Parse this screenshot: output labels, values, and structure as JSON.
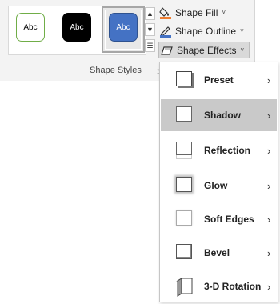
{
  "gallery": {
    "swatches": [
      {
        "label": "Abc"
      },
      {
        "label": "Abc"
      },
      {
        "label": "Abc"
      }
    ],
    "group_label": "Shape Styles"
  },
  "commands": {
    "fill_label": "Shape Fill",
    "outline_label": "Shape Outline",
    "effects_label": "Shape Effects"
  },
  "menu": {
    "items": [
      {
        "label": "Preset"
      },
      {
        "label": "Shadow"
      },
      {
        "label": "Reflection"
      },
      {
        "label": "Glow"
      },
      {
        "label": "Soft Edges"
      },
      {
        "label": "Bevel"
      },
      {
        "label": "3-D Rotation"
      }
    ],
    "highlighted": "Shadow"
  },
  "colors": {
    "fill_accent": "#ed7d31",
    "outline_accent": "#4472c4",
    "swatch_outline": "#70ad47",
    "swatch_dark": "#000000",
    "swatch_blue": "#4472c4",
    "highlight": "#c9c9c9"
  }
}
